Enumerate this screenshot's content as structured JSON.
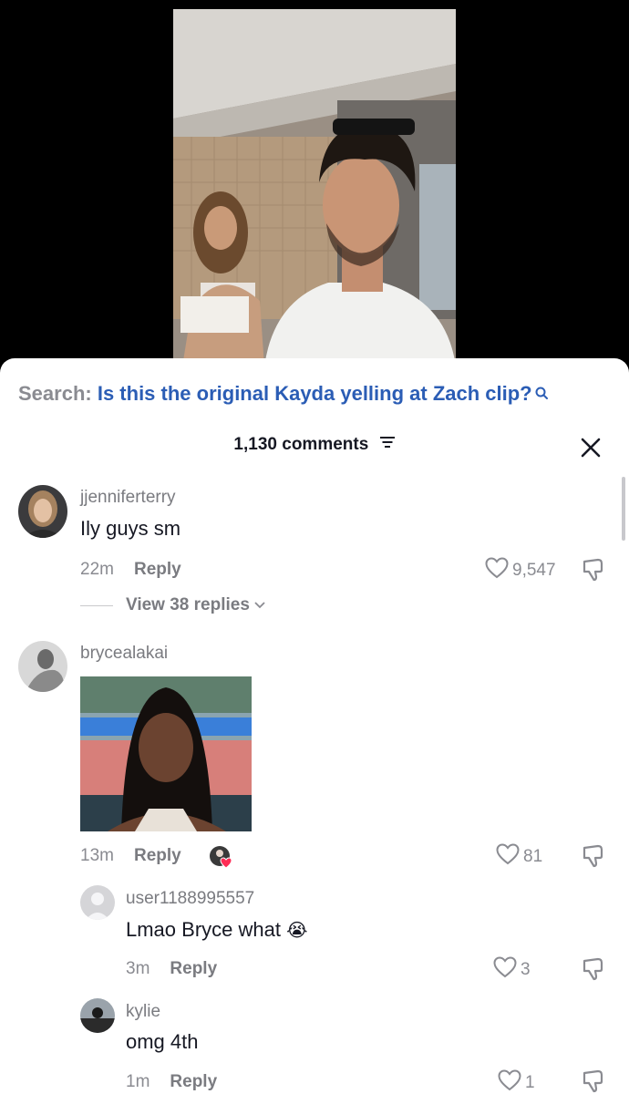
{
  "search": {
    "prefix": "Search:",
    "query": "Is this the original Kayda yelling at Zach clip?"
  },
  "header": {
    "count_label": "1,130 comments"
  },
  "comments": [
    {
      "username": "jjenniferterry",
      "text": "Ily guys sm",
      "time": "22m",
      "reply_label": "Reply",
      "likes": "9,547",
      "view_replies": "View 38 replies"
    },
    {
      "username": "brycealakai",
      "text": "",
      "time": "13m",
      "reply_label": "Reply",
      "likes": "81",
      "has_image": true,
      "liked_by_creator": true
    }
  ],
  "replies": [
    {
      "username": "user1188995557",
      "text": "Lmao Bryce what",
      "emoji": "😭",
      "time": "3m",
      "reply_label": "Reply",
      "likes": "3"
    },
    {
      "username": "kylie",
      "text": "omg 4th",
      "time": "1m",
      "reply_label": "Reply",
      "likes": "1"
    }
  ],
  "colors": {
    "search_query": "#2b5db5",
    "sheet_bg": "#ffffff",
    "muted_text": "#8a8b91"
  },
  "icons": [
    "search-icon",
    "filter-icon",
    "close-icon",
    "heart-outline-icon",
    "dislike-icon",
    "chevron-down-icon"
  ]
}
